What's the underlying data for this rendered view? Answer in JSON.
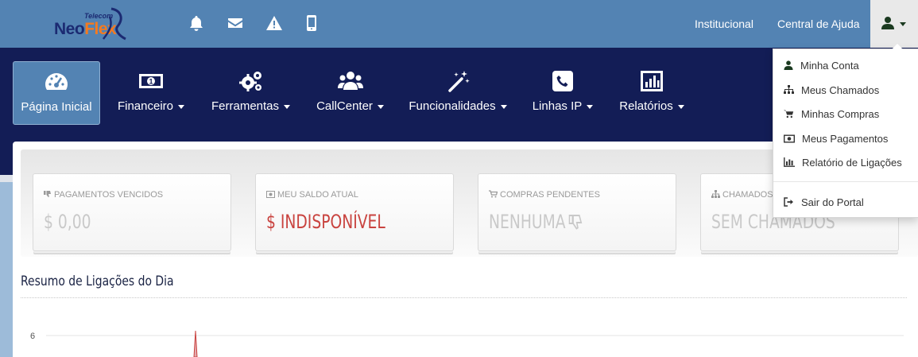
{
  "brand": {
    "logo_small": "Telecom",
    "logo_neo": "Neo",
    "logo_flex": "Flex",
    "color_navy": "#131d56",
    "color_blue": "#5383b3",
    "color_orange": "#f47a20"
  },
  "topbar": {
    "icons": [
      "bell-icon",
      "envelope-icon",
      "warning-icon",
      "mobile-icon"
    ],
    "links": {
      "institucional": "Institucional",
      "ajuda": "Central de Ajuda"
    },
    "user_icon": "user-icon"
  },
  "nav": {
    "items": [
      {
        "label": "Página Inicial",
        "icon": "dashboard-icon",
        "active": true
      },
      {
        "label": "Financeiro",
        "icon": "money-icon"
      },
      {
        "label": "Ferramentas",
        "icon": "gears-icon"
      },
      {
        "label": "CallCenter",
        "icon": "users-icon"
      },
      {
        "label": "Funcionalidades",
        "icon": "magic-wand-icon"
      },
      {
        "label": "Linhas IP",
        "icon": "phone-icon"
      },
      {
        "label": "Relatórios",
        "icon": "bar-chart-icon"
      }
    ]
  },
  "cards": [
    {
      "label": "PAGAMENTOS VENCIDOS",
      "value": "$ 0,00",
      "icon": "thumbs-down-icon"
    },
    {
      "label": "MEU SALDO ATUAL",
      "value": "$ INDISPONÍVEL",
      "icon": "money-icon",
      "value_color": "#c9433f"
    },
    {
      "label": "COMPRAS PENDENTES",
      "value": "NENHUMA",
      "icon": "cart-icon"
    },
    {
      "label": "CHAMADOS",
      "value": "SEM CHAMADOS",
      "icon": "sitemap-icon"
    }
  ],
  "section": {
    "title": "Resumo de Ligações do Dia"
  },
  "chart_data": {
    "type": "line",
    "series": [
      {
        "values": [
          6
        ]
      }
    ],
    "y_ticks": [
      "6"
    ],
    "grid": true
  },
  "dropdown": {
    "items": [
      {
        "label": "Minha Conta",
        "icon": "user-icon"
      },
      {
        "label": "Meus Chamados",
        "icon": "sitemap-icon"
      },
      {
        "label": "Minhas Compras",
        "icon": "cart-icon"
      },
      {
        "label": "Meus Pagamentos",
        "icon": "money-icon"
      },
      {
        "label": "Relatório de Ligações",
        "icon": "bar-chart-icon"
      }
    ],
    "logout": {
      "label": "Sair do Portal",
      "icon": "sign-out-icon"
    }
  }
}
